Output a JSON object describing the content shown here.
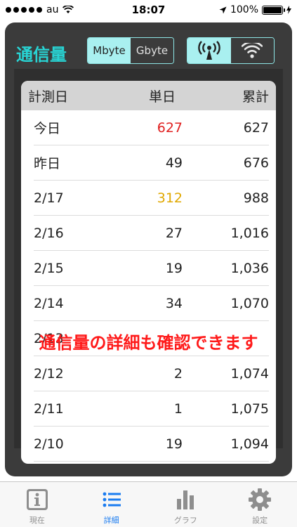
{
  "status_bar": {
    "carrier": "au",
    "time": "18:07",
    "battery": "100%"
  },
  "header": {
    "title": "通信量",
    "unit_options": [
      "Mbyte",
      "Gbyte"
    ],
    "unit_selected": "Mbyte",
    "network_selected": "cellular"
  },
  "table": {
    "columns": [
      "計測日",
      "単日",
      "累計"
    ],
    "rows": [
      {
        "date": "今日",
        "daily": "627",
        "total": "627",
        "daily_color": "#e02020"
      },
      {
        "date": "昨日",
        "daily": "49",
        "total": "676",
        "daily_color": "#222222"
      },
      {
        "date": "2/17",
        "daily": "312",
        "total": "988",
        "daily_color": "#e0a800"
      },
      {
        "date": "2/16",
        "daily": "27",
        "total": "1,016",
        "daily_color": "#222222"
      },
      {
        "date": "2/15",
        "daily": "19",
        "total": "1,036",
        "daily_color": "#222222"
      },
      {
        "date": "2/14",
        "daily": "34",
        "total": "1,070",
        "daily_color": "#222222"
      },
      {
        "date": "2/13",
        "daily": "",
        "total": "",
        "daily_color": "#222222"
      },
      {
        "date": "2/12",
        "daily": "2",
        "total": "1,074",
        "daily_color": "#222222"
      },
      {
        "date": "2/11",
        "daily": "1",
        "total": "1,075",
        "daily_color": "#222222"
      },
      {
        "date": "2/10",
        "daily": "19",
        "total": "1,094",
        "daily_color": "#222222"
      }
    ]
  },
  "banner": "通信量の詳細も確認できます",
  "tabbar": {
    "items": [
      {
        "label": "現在",
        "icon": "info-icon"
      },
      {
        "label": "詳細",
        "icon": "list-icon"
      },
      {
        "label": "グラフ",
        "icon": "bar-chart-icon"
      },
      {
        "label": "設定",
        "icon": "gear-icon"
      }
    ],
    "active_index": 1
  },
  "colors": {
    "accent": "#28d4d4",
    "tab_active": "#1b7cf0",
    "banner": "#ff1a1a"
  }
}
